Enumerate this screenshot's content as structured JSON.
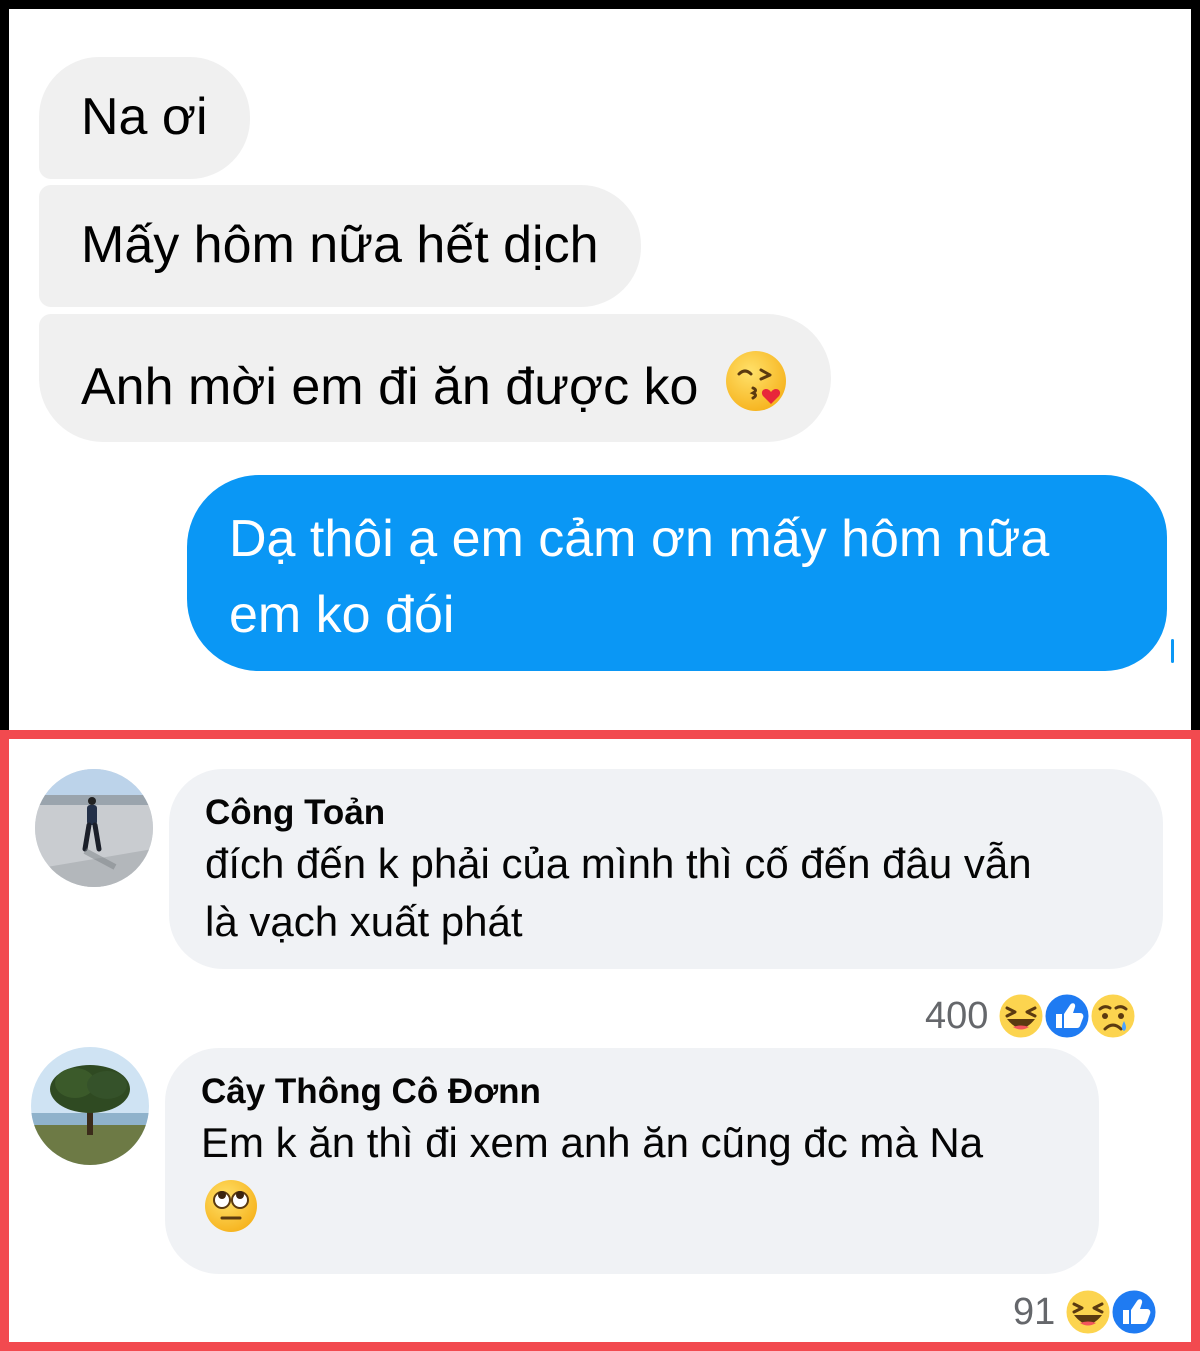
{
  "chat": {
    "incoming": [
      {
        "text": "Na ơi"
      },
      {
        "text": "Mấy hôm nữa hết dịch"
      },
      {
        "text": "Anh mời em đi ăn được ko",
        "emoji_icon": "face-blowing-kiss-icon"
      }
    ],
    "outgoing": {
      "line1": "Dạ thôi ạ em cảm ơn mấy hôm nữa",
      "line2": "em ko đói"
    },
    "colors": {
      "outgoing_bubble": "#0a97f5",
      "incoming_bubble": "#f0f0f0"
    }
  },
  "comments": [
    {
      "author": "Công Toản",
      "line1": "đích đến k phải của mình thì cố đến đâu vẫn",
      "line2": "là vạch xuất phát",
      "reaction_count": "400",
      "reactions": [
        "haha-icon",
        "like-icon",
        "sad-icon"
      ],
      "avatar_icon": "avatar-person-on-runway"
    },
    {
      "author": "Cây Thông Cô Đơnn",
      "line1": "Em k ăn thì đi xem anh ăn cũng đc mà Na",
      "emoji_icon": "face-rolling-eyes-icon",
      "reaction_count": "91",
      "reactions": [
        "haha-icon",
        "like-icon"
      ],
      "avatar_icon": "avatar-lone-tree"
    }
  ],
  "theme": {
    "highlight_border": "#f24a4f",
    "comment_bubble": "#f0f2f5"
  }
}
